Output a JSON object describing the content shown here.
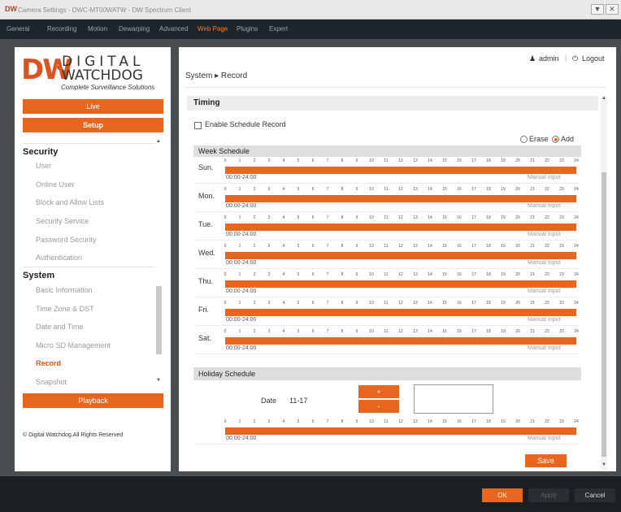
{
  "window": {
    "title": "Camera Settings - DWC-MT00WATW - DW Spectrum Client",
    "logo": "DW",
    "buttons": [
      "▼",
      "✕"
    ]
  },
  "menubar": {
    "items": [
      "General",
      "Recording",
      "Motion",
      "Dewarping",
      "Advanced",
      "Web Page",
      "Plugins",
      "Expert"
    ],
    "active": "Web Page"
  },
  "header": {
    "user": "admin",
    "logout": "Logout",
    "breadcrumb": "System ▸ Record"
  },
  "sidebar": {
    "logo_dw": "DW",
    "logo_digital": "DIGITAL",
    "logo_watchdog": "WATCHDOG",
    "logo_tagline": "Complete Surveillance Solutions",
    "live": "Live",
    "setup": "Setup",
    "security_head": "Security",
    "security_items": [
      "User",
      "Online User",
      "Block and Allow Lists",
      "Security Service",
      "Password Security",
      "Authentication"
    ],
    "system_head": "System",
    "system_items": [
      "Basic Information",
      "Time Zone & DST",
      "Date and Time",
      "Micro SD Management",
      "Record",
      "Snapshot"
    ],
    "selected": "Record",
    "playback": "Playback",
    "copyright": "© Digital Watchdog.All Rights Reserved"
  },
  "content": {
    "section_title": "Timing",
    "enable_label": "Enable Schedule Record",
    "erase_label": "Erase",
    "add_label": "Add",
    "mode": "Add",
    "week_title": "Week Schedule",
    "hours": [
      "0",
      "1",
      "2",
      "3",
      "4",
      "5",
      "6",
      "7",
      "8",
      "9",
      "10",
      "11",
      "12",
      "13",
      "14",
      "15",
      "16",
      "17",
      "18",
      "19",
      "20",
      "21",
      "22",
      "23",
      "24"
    ],
    "days": [
      {
        "label": "Sun.",
        "time": "00:00-24:00",
        "manual": "Manual Input"
      },
      {
        "label": "Mon.",
        "time": "00:00-24:00",
        "manual": "Manual Input"
      },
      {
        "label": "Tue.",
        "time": "00:00-24:00",
        "manual": "Manual Input"
      },
      {
        "label": "Wed.",
        "time": "00:00-24:00",
        "manual": "Manual Input"
      },
      {
        "label": "Thu.",
        "time": "00:00-24:00",
        "manual": "Manual Input"
      },
      {
        "label": "Fri.",
        "time": "00:00-24:00",
        "manual": "Manual Input"
      },
      {
        "label": "Sat.",
        "time": "00:00-24:00",
        "manual": "Manual Input"
      }
    ],
    "holiday_title": "Holiday Schedule",
    "date_label": "Date",
    "date_value": "11-17",
    "plus": "+",
    "minus": "-",
    "holiday_time": "00:00-24:00",
    "holiday_manual": "Manual Input",
    "save": "Save"
  },
  "dialog": {
    "ok": "OK",
    "apply": "Apply",
    "cancel": "Cancel"
  },
  "colors": {
    "accent": "#e8661f",
    "menubar": "#1f262b",
    "bottombar": "#1c1f22"
  }
}
